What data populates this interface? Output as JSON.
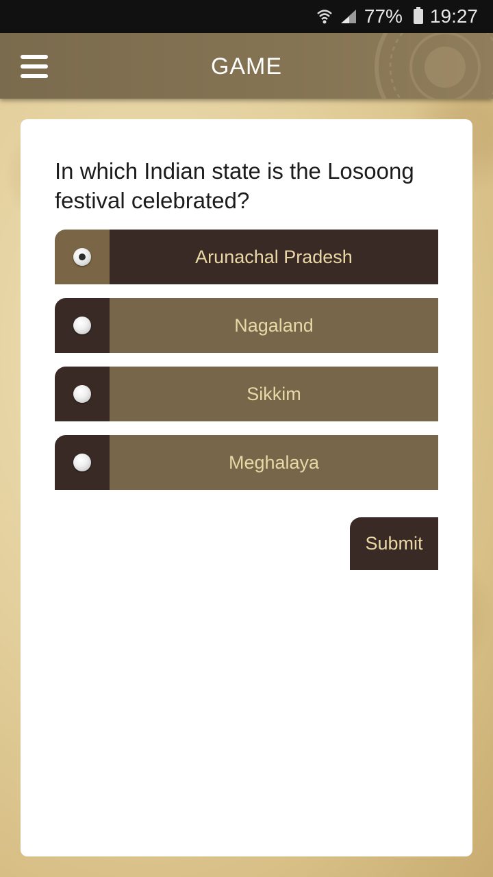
{
  "status_bar": {
    "battery": "77%",
    "time": "19:27",
    "icons": [
      "wifi-icon",
      "signal-icon",
      "battery-icon"
    ]
  },
  "app_bar": {
    "title": "GAME",
    "menu_icon": "hamburger-menu-icon"
  },
  "quiz": {
    "question": "In which Indian state is the Losoong festival celebrated?",
    "options": [
      {
        "label": "Arunachal Pradesh",
        "selected": true
      },
      {
        "label": "Nagaland",
        "selected": false
      },
      {
        "label": "Sikkim",
        "selected": false
      },
      {
        "label": "Meghalaya",
        "selected": false
      }
    ],
    "submit_label": "Submit"
  },
  "colors": {
    "app_bar": "#7b6b4e",
    "dark_cell": "#3a2a25",
    "light_cell": "#77664a",
    "option_text": "#e9d8a6",
    "card": "#ffffff"
  }
}
